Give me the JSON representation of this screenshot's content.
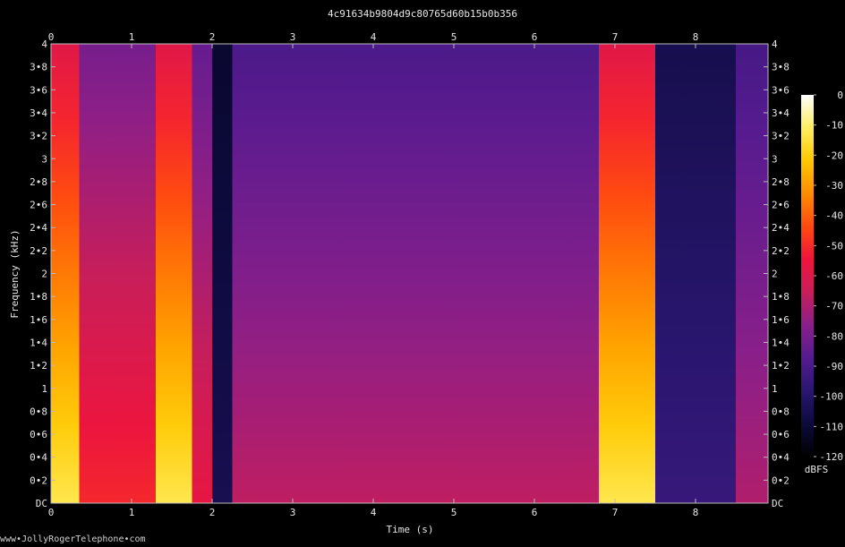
{
  "page": {
    "title": "4c91634b9804d9c80765d60b15b0b356",
    "footer": "www•JollyRogerTelephone•com"
  },
  "chart_data": {
    "type": "heatmap",
    "title": "4c91634b9804d9c80765d60b15b0b356",
    "xlabel": "Time (s)",
    "ylabel": "Frequency (kHz)",
    "xlim": [
      0,
      8.9
    ],
    "ylim": [
      0,
      4
    ],
    "x_ticks": [
      {
        "value": 0,
        "label": "0"
      },
      {
        "value": 1,
        "label": "1"
      },
      {
        "value": 2,
        "label": "2"
      },
      {
        "value": 3,
        "label": "3"
      },
      {
        "value": 4,
        "label": "4"
      },
      {
        "value": 5,
        "label": "5"
      },
      {
        "value": 6,
        "label": "6"
      },
      {
        "value": 7,
        "label": "7"
      },
      {
        "value": 8,
        "label": "8"
      }
    ],
    "y_ticks": [
      {
        "value": 0,
        "label": "DC"
      },
      {
        "value": 0.2,
        "label": "0•2"
      },
      {
        "value": 0.4,
        "label": "0•4"
      },
      {
        "value": 0.6,
        "label": "0•6"
      },
      {
        "value": 0.8,
        "label": "0•8"
      },
      {
        "value": 1,
        "label": "1"
      },
      {
        "value": 1.2,
        "label": "1•2"
      },
      {
        "value": 1.4,
        "label": "1•4"
      },
      {
        "value": 1.6,
        "label": "1•6"
      },
      {
        "value": 1.8,
        "label": "1•8"
      },
      {
        "value": 2,
        "label": "2"
      },
      {
        "value": 2.2,
        "label": "2•2"
      },
      {
        "value": 2.4,
        "label": "2•4"
      },
      {
        "value": 2.6,
        "label": "2•6"
      },
      {
        "value": 2.8,
        "label": "2•8"
      },
      {
        "value": 3,
        "label": "3"
      },
      {
        "value": 3.2,
        "label": "3•2"
      },
      {
        "value": 3.4,
        "label": "3•4"
      },
      {
        "value": 3.6,
        "label": "3•6"
      },
      {
        "value": 3.8,
        "label": "3•8"
      },
      {
        "value": 4,
        "label": "4"
      }
    ],
    "colorbar": {
      "unit": "dBFS",
      "range": [
        -120,
        0
      ],
      "ticks": [
        {
          "value": 0,
          "label": "0"
        },
        {
          "value": -10,
          "label": "-10"
        },
        {
          "value": -20,
          "label": "-20"
        },
        {
          "value": -30,
          "label": "-30"
        },
        {
          "value": -40,
          "label": "-40"
        },
        {
          "value": -50,
          "label": "-50"
        },
        {
          "value": -60,
          "label": "-60"
        },
        {
          "value": -70,
          "label": "-70"
        },
        {
          "value": -80,
          "label": "-80"
        },
        {
          "value": -90,
          "label": "-90"
        },
        {
          "value": -100,
          "label": "-100"
        },
        {
          "value": -110,
          "label": "-110"
        },
        {
          "value": -120,
          "label": "-120"
        }
      ],
      "colors": [
        "#000000",
        "#0c0a3c",
        "#2a1670",
        "#551b90",
        "#8a1f8a",
        "#c81e5a",
        "#f0143c",
        "#ff4a10",
        "#ff8c00",
        "#ffc800",
        "#ffee60",
        "#ffffff"
      ]
    },
    "segments": [
      {
        "start": 0.0,
        "end": 0.35,
        "level": 0.85
      },
      {
        "start": 0.35,
        "end": 1.3,
        "level": 0.55
      },
      {
        "start": 1.3,
        "end": 1.75,
        "level": 0.85
      },
      {
        "start": 1.75,
        "end": 2.0,
        "level": 0.5
      },
      {
        "start": 2.0,
        "end": 2.25,
        "level": 0.12
      },
      {
        "start": 2.25,
        "end": 6.8,
        "level": 0.42
      },
      {
        "start": 6.8,
        "end": 7.5,
        "level": 0.85
      },
      {
        "start": 7.5,
        "end": 8.5,
        "level": 0.2
      },
      {
        "start": 8.5,
        "end": 8.9,
        "level": 0.4
      }
    ]
  }
}
